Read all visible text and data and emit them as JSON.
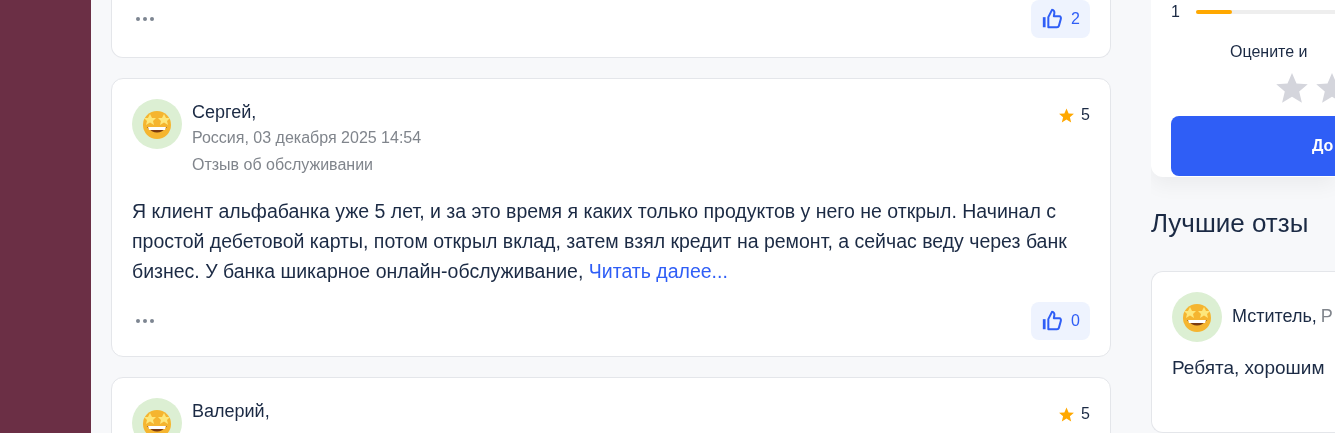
{
  "reviews": [
    {
      "kind": "tail",
      "likes": "2"
    },
    {
      "kind": "full",
      "name": "Сергей,",
      "meta": "Россия, 03 декабря 2025 14:54",
      "category": "Отзыв об обслуживании",
      "rating": "5",
      "text": "Я клиент альфабанка уже 5 лет, и за это время я каких только продуктов у него не открыл. Начинал с простой дебетовой карты, потом открыл вклад, затем взял кредит на ремонт, а сейчас веду через банк бизнес. У банка шикарное онлайн-обслуживание,",
      "more": "Читать далее...",
      "likes": "0"
    },
    {
      "kind": "full",
      "name": "Валерий,",
      "rating": "5"
    }
  ],
  "rating_panel": {
    "row": {
      "label": "1",
      "level": 0.12
    },
    "prompt": "Оцените и",
    "button": "До"
  },
  "best_reviews": {
    "title": "Лучшие отзы",
    "review": {
      "name": "Мститель,",
      "meta": "Р",
      "text": "Ребята, хорошим"
    }
  }
}
